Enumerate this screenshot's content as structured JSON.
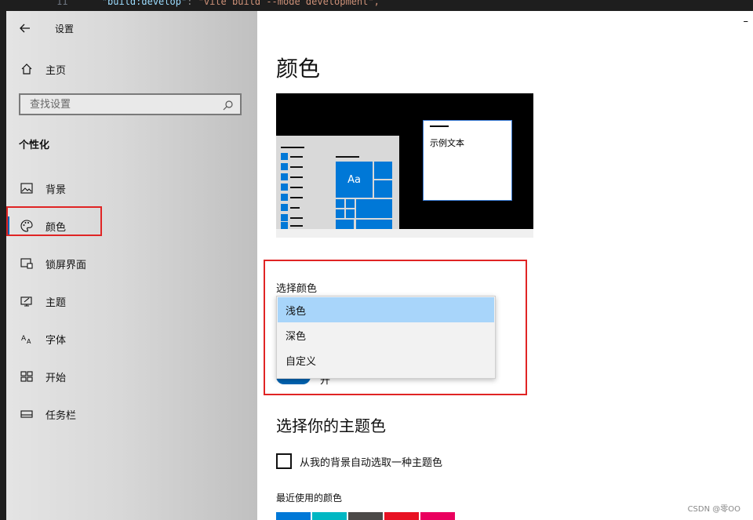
{
  "editor": {
    "line_number": "11",
    "code_key": "\"build:develop\"",
    "code_sep": ": ",
    "code_value": "\"vite build --mode development\","
  },
  "sidebar": {
    "title": "设置",
    "home": "主页",
    "search_placeholder": "查找设置",
    "group": "个性化",
    "items": [
      {
        "label": "背景",
        "icon": "picture-icon"
      },
      {
        "label": "颜色",
        "icon": "palette-icon"
      },
      {
        "label": "锁屏界面",
        "icon": "lock-screen-icon"
      },
      {
        "label": "主题",
        "icon": "theme-icon"
      },
      {
        "label": "字体",
        "icon": "font-icon"
      },
      {
        "label": "开始",
        "icon": "start-icon"
      },
      {
        "label": "任务栏",
        "icon": "taskbar-icon"
      }
    ],
    "active_index": 1
  },
  "main": {
    "minimize": "–",
    "title": "颜色",
    "preview": {
      "sample_text": "示例文本",
      "tile_label": "Aa"
    },
    "choose_color_label": "选择颜色",
    "dropdown_options": [
      "浅色",
      "深色",
      "自定义"
    ],
    "dropdown_selected_index": 0,
    "toggle_text": "开",
    "accent_title": "选择你的主题色",
    "auto_pick_label": "从我的背景自动选取一种主题色",
    "auto_pick_checked": false,
    "recent_colors_label": "最近使用的颜色",
    "recent_colors": [
      "#0078d7",
      "#00b7c3",
      "#4c4a48",
      "#e81123",
      "#ea005e"
    ]
  },
  "colors": {
    "accent": "#0078d7",
    "highlight_border": "#e02424",
    "selected_option": "#a8d5fa"
  },
  "watermark": "CSDN @零OO"
}
